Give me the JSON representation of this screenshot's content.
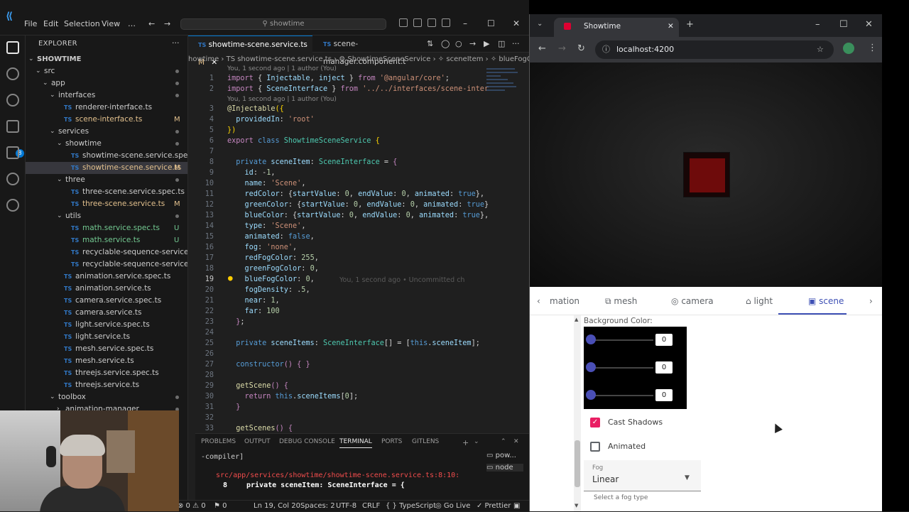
{
  "vscode": {
    "menu": [
      "File",
      "Edit",
      "Selection",
      "View",
      "…"
    ],
    "search": "showtime",
    "explorer_title": "EXPLORER",
    "project": "SHOWTIME",
    "tree": [
      {
        "label": "src",
        "type": "folder",
        "indent": 0,
        "open": true,
        "status": ""
      },
      {
        "label": "app",
        "type": "folder",
        "indent": 1,
        "open": true,
        "status": ""
      },
      {
        "label": "interfaces",
        "type": "folder",
        "indent": 2,
        "open": true,
        "status": ""
      },
      {
        "label": "renderer-interface.ts",
        "type": "ts",
        "indent": 3,
        "status": ""
      },
      {
        "label": "scene-interface.ts",
        "type": "ts",
        "indent": 3,
        "status": "M"
      },
      {
        "label": "services",
        "type": "folder",
        "indent": 2,
        "open": true,
        "status": ""
      },
      {
        "label": "showtime",
        "type": "folder",
        "indent": 3,
        "open": true,
        "status": ""
      },
      {
        "label": "showtime-scene.service.spec.ts",
        "type": "ts",
        "indent": 4,
        "status": ""
      },
      {
        "label": "showtime-scene.service.ts",
        "type": "ts",
        "indent": 4,
        "status": "M",
        "selected": true
      },
      {
        "label": "three",
        "type": "folder",
        "indent": 3,
        "open": true,
        "status": ""
      },
      {
        "label": "three-scene.service.spec.ts",
        "type": "ts",
        "indent": 4,
        "status": ""
      },
      {
        "label": "three-scene.service.ts",
        "type": "ts",
        "indent": 4,
        "status": "M"
      },
      {
        "label": "utils",
        "type": "folder",
        "indent": 3,
        "open": true,
        "status": ""
      },
      {
        "label": "math.service.spec.ts",
        "type": "ts",
        "indent": 4,
        "status": "U"
      },
      {
        "label": "math.service.ts",
        "type": "ts",
        "indent": 4,
        "status": "U"
      },
      {
        "label": "recyclable-sequence-service.service.sp...",
        "type": "ts",
        "indent": 4,
        "status": ""
      },
      {
        "label": "recyclable-sequence-service.service.ts",
        "type": "ts",
        "indent": 4,
        "status": ""
      },
      {
        "label": "animation.service.spec.ts",
        "type": "ts",
        "indent": 3,
        "status": ""
      },
      {
        "label": "animation.service.ts",
        "type": "ts",
        "indent": 3,
        "status": ""
      },
      {
        "label": "camera.service.spec.ts",
        "type": "ts",
        "indent": 3,
        "status": ""
      },
      {
        "label": "camera.service.ts",
        "type": "ts",
        "indent": 3,
        "status": ""
      },
      {
        "label": "light.service.spec.ts",
        "type": "ts",
        "indent": 3,
        "status": ""
      },
      {
        "label": "light.service.ts",
        "type": "ts",
        "indent": 3,
        "status": ""
      },
      {
        "label": "mesh.service.spec.ts",
        "type": "ts",
        "indent": 3,
        "status": ""
      },
      {
        "label": "mesh.service.ts",
        "type": "ts",
        "indent": 3,
        "status": ""
      },
      {
        "label": "threejs.service.spec.ts",
        "type": "ts",
        "indent": 3,
        "status": ""
      },
      {
        "label": "threejs.service.ts",
        "type": "ts",
        "indent": 3,
        "status": ""
      },
      {
        "label": "toolbox",
        "type": "folder",
        "indent": 2,
        "open": true,
        "status": ""
      },
      {
        "label": "animation-manager",
        "type": "folder",
        "indent": 3,
        "open": false,
        "status": ""
      }
    ],
    "tabs": [
      {
        "label": "showtime-scene.service.ts",
        "status": "M",
        "active": true
      },
      {
        "label": "scene-manager.component.t",
        "status": "",
        "active": false
      }
    ],
    "breadcrumb": "howtime › TS showtime-scene.service.ts › ⚙ ShowtimeSceneService › ✧ sceneItem › ✧ blueFogColor",
    "codelens": [
      "You, 1 second ago | 1 author (You)",
      "You, 1 second ago | 1 author (You)"
    ],
    "ghost": "You, 1 second ago • Uncommitted ch",
    "panel_tabs": [
      "PROBLEMS",
      "OUTPUT",
      "DEBUG CONSOLE",
      "TERMINAL",
      "PORTS",
      "GITLENS"
    ],
    "terminal": {
      "line1": "-compiler]",
      "line2": "src/app/services/showtime/showtime-scene.service.ts:8:10:",
      "line3_num": "8",
      "line3": "private sceneItem: SceneInterface = {",
      "procs": [
        "pow...",
        "node"
      ]
    },
    "status": {
      "errors": "⊗ 0 ⚠ 0",
      "ports": "⚑ 0",
      "pos": "Ln 19, Col 20",
      "spaces": "Spaces: 2",
      "enc": "UTF-8",
      "eol": "CRLF",
      "lang": "{ } TypeScript",
      "live": "◎ Go Live",
      "prettier": "✓ Prettier",
      "bell": "🔔"
    }
  },
  "browser": {
    "tab_title": "Showtime",
    "url": "localhost:4200",
    "nav_tabs": [
      {
        "label": "mation",
        "icon": ""
      },
      {
        "label": "mesh",
        "icon": "⧉"
      },
      {
        "label": "camera",
        "icon": "◎"
      },
      {
        "label": "light",
        "icon": "⌂"
      },
      {
        "label": "scene",
        "icon": "▣",
        "active": true
      }
    ],
    "background_label": "Background Color:",
    "slider_values": [
      "0",
      "0",
      "0"
    ],
    "cast_shadows": {
      "label": "Cast Shadows",
      "checked": true
    },
    "animated": {
      "label": "Animated",
      "checked": false
    },
    "fog_field": {
      "label": "Fog",
      "value": "Linear"
    },
    "fog_hint": "Select a fog type",
    "accent": "#3f51b5",
    "checkbox_color": "#e91e63",
    "cube_color": "#6e0b0b"
  }
}
